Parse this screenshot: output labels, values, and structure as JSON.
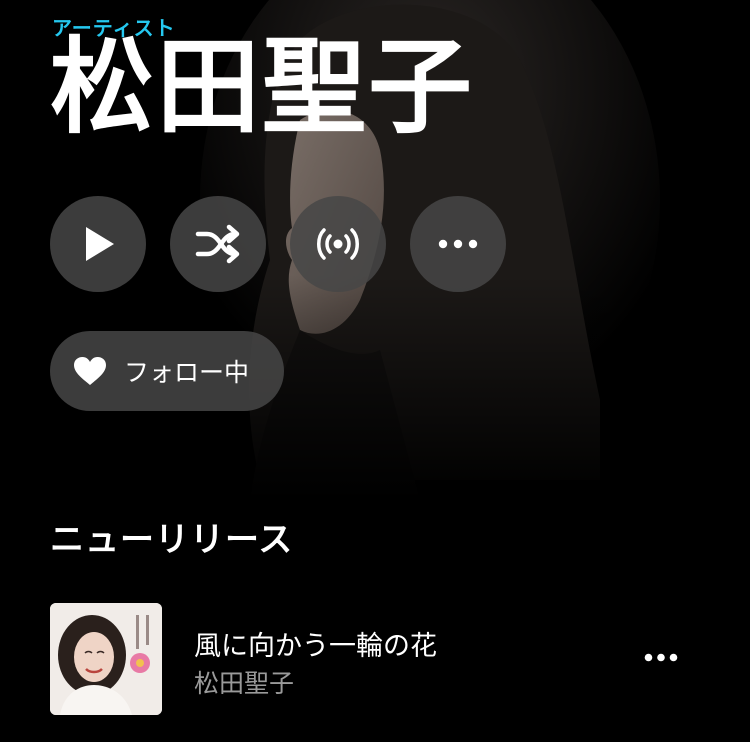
{
  "header": {
    "type_label": "アーティスト",
    "artist_name": "松田聖子"
  },
  "actions": {
    "play_icon": "play-icon",
    "shuffle_icon": "shuffle-icon",
    "radio_icon": "radio-broadcast-icon",
    "more_icon": "more-horizontal-icon"
  },
  "follow": {
    "label": "フォロー中",
    "icon": "heart-icon"
  },
  "new_releases": {
    "title": "ニューリリース",
    "items": [
      {
        "title": "風に向かう一輪の花",
        "artist": "松田聖子",
        "more_icon": "more-horizontal-icon"
      }
    ]
  },
  "colors": {
    "accent": "#25c8f0",
    "background": "#000000",
    "button_bg": "#464646",
    "secondary_text": "#9a9a9a"
  }
}
